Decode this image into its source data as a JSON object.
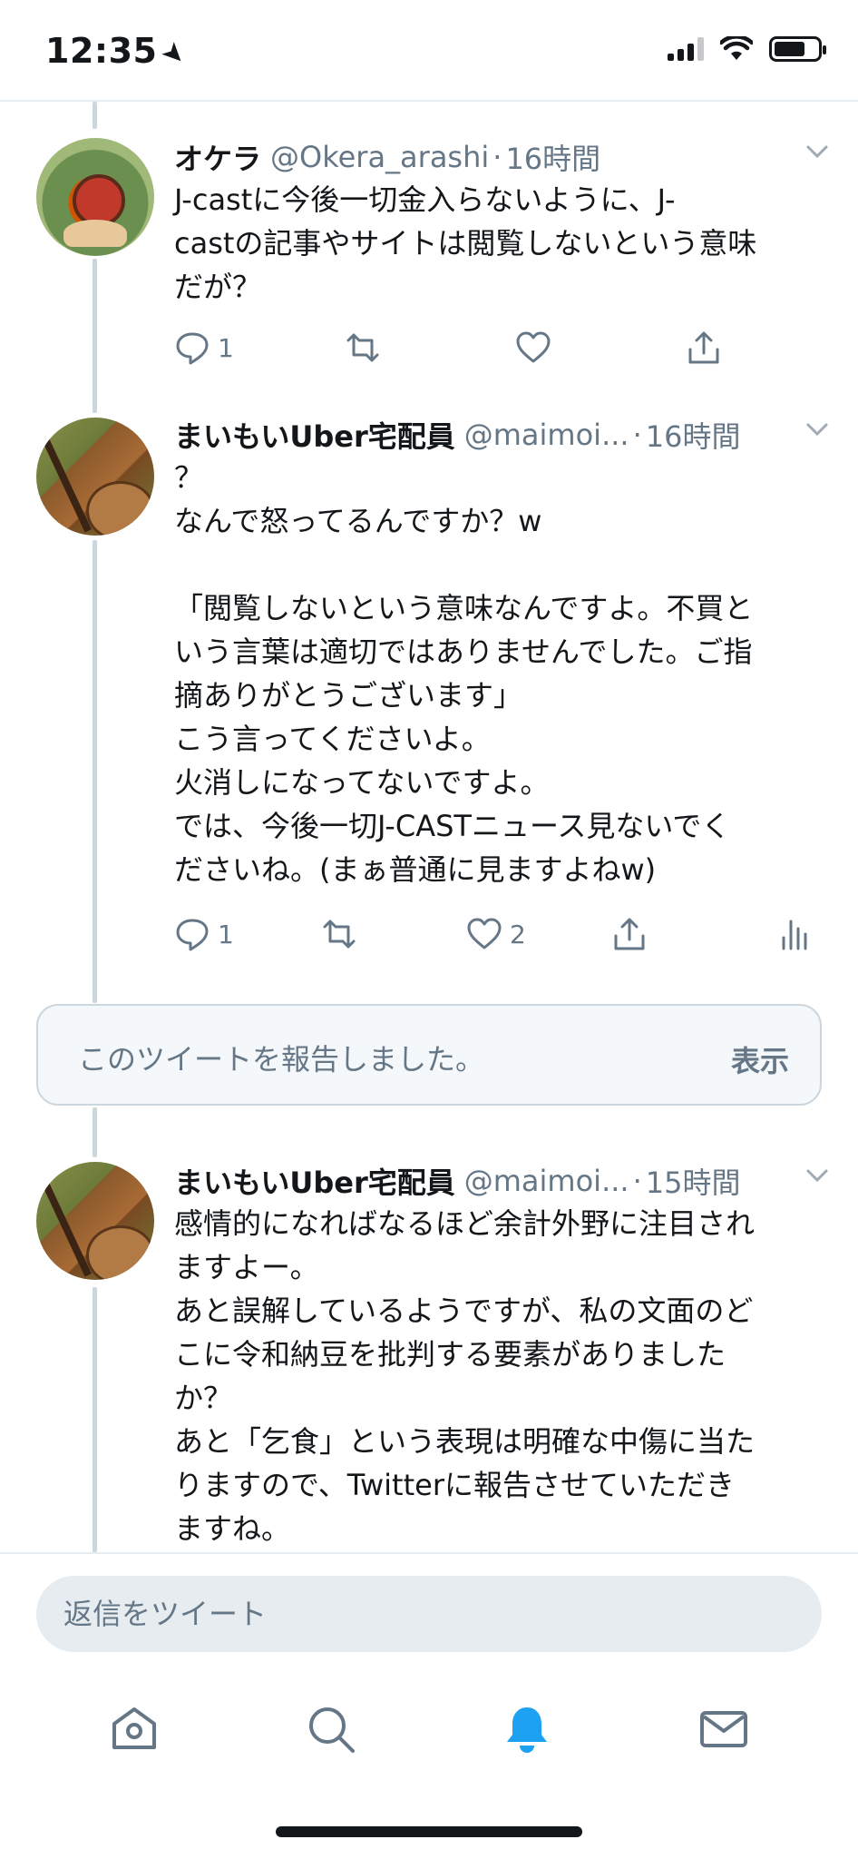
{
  "status_bar": {
    "time": "12:35"
  },
  "tweets": [
    {
      "name": "オケラ",
      "handle": "@Okera_arashi",
      "time": "16時間",
      "text": "J-castに今後一切金入らないように、J-\ncastの記事やサイトは閲覧しないという意味\nだが？",
      "reply_count": "1",
      "like_count": ""
    },
    {
      "name": "まいもいUber宅配員",
      "handle": "@maimoi...",
      "time": "16時間",
      "text": "？\nなんで怒ってるんですか？w\n\n「閲覧しないという意味なんですよ。不買と\nいう言葉は適切ではありませんでした。ご指\n摘ありがとうございます」\nこう言ってくださいよ。\n火消しになってないですよ。\nでは、今後一切J-CASTニュース見ないでく\nださいね。(まぁ普通に見ますよねw)",
      "reply_count": "1",
      "like_count": "2"
    },
    {
      "name": "まいもいUber宅配員",
      "handle": "@maimoi...",
      "time": "15時間",
      "text": "感情的になればなるほど余計外野に注目され\nますよー。\nあと誤解しているようですが、私の文面のど\nこに令和納豆を批判する要素がありました\nか？\nあと「乞食」という表現は明確な中傷に当た\nりますので、Twitterに報告させていただき\nますね。"
    }
  ],
  "report": {
    "text": "このツイートを報告しました。",
    "show_label": "表示"
  },
  "reply": {
    "placeholder": "返信をツイート"
  },
  "tabs": [
    {
      "icon": "home-icon"
    },
    {
      "icon": "search-icon"
    },
    {
      "icon": "notifications-icon",
      "active": true
    },
    {
      "icon": "messages-icon"
    }
  ],
  "colors": {
    "accent": "#1da1f2",
    "muted": "#657786",
    "text": "#14171a",
    "border": "#ccd6dd"
  }
}
